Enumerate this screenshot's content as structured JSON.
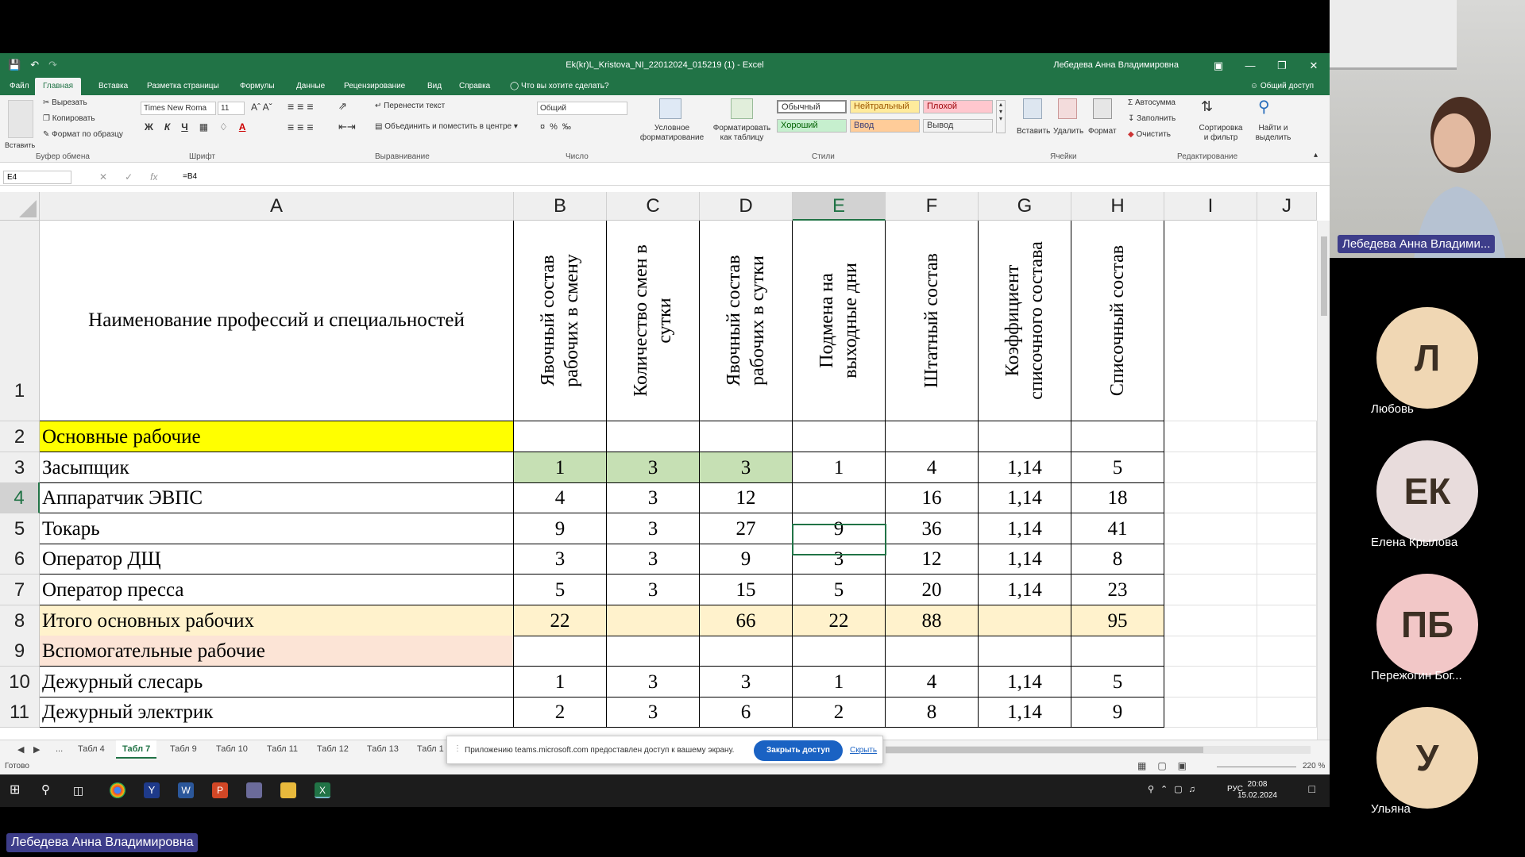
{
  "excel": {
    "doc_title": "Ek(kr)L_Kristova_NI_22012024_015219 (1)  -  Excel",
    "user": "Лебедева Анна Владимировна",
    "menu_tabs": [
      "Файл",
      "Главная",
      "Вставка",
      "Разметка страницы",
      "Формулы",
      "Данные",
      "Рецензирование",
      "Вид",
      "Справка",
      "Что вы хотите сделать?"
    ],
    "share": "Общий доступ",
    "ribbon": {
      "paste": "Вставить",
      "cut": "Вырезать",
      "copy": "Копировать",
      "format_painter": "Формат по образцу",
      "clipboard": "Буфер обмена",
      "font_name": "Times New Roma",
      "font_size": "11",
      "font_group": "Шрифт",
      "wrap": "Перенести текст",
      "merge": "Объединить и поместить в центре",
      "align_group": "Выравнивание",
      "number_format": "Общий",
      "number_group": "Число",
      "cond_format": "Условное форматирование",
      "format_table": "Форматировать как таблицу",
      "styles": [
        "Обычный",
        "Нейтральный",
        "Плохой",
        "Хороший",
        "Ввод",
        "Вывод"
      ],
      "styles_group": "Стили",
      "insert": "Вставить",
      "delete": "Удалить",
      "format": "Формат",
      "cells_group": "Ячейки",
      "autosum": "Автосумма",
      "fill": "Заполнить",
      "clear": "Очистить",
      "sort": "Сортировка и фильтр",
      "find": "Найти и выделить",
      "edit_group": "Редактирование"
    },
    "name_box": "E4",
    "formula": "=B4",
    "col_headers": [
      "A",
      "B",
      "C",
      "D",
      "E",
      "F",
      "G",
      "H",
      "I",
      "J"
    ],
    "header_row": {
      "A": "Наименование профессий и специальностей",
      "B": "Явочный состав рабочих в смену",
      "C": "Количество смен в сутки",
      "D": "Явочный состав рабочих в сутки",
      "E": "Подмена на выходные дни",
      "F": "Штатный состав",
      "G": "Коэффициент списочного состава",
      "H": "Списочный состав"
    },
    "rows": [
      {
        "n": "2",
        "cells": [
          "Основные рабочие",
          "",
          "",
          "",
          "",
          "",
          "",
          ""
        ]
      },
      {
        "n": "3",
        "cells": [
          "Засыпщик",
          "1",
          "3",
          "3",
          "1",
          "4",
          "1,14",
          "5"
        ]
      },
      {
        "n": "4",
        "cells": [
          "Аппаратчик ЭВПС",
          "4",
          "3",
          "12",
          "",
          "16",
          "1,14",
          "18"
        ]
      },
      {
        "n": "5",
        "cells": [
          "Токарь",
          "9",
          "3",
          "27",
          "9",
          "36",
          "1,14",
          "41"
        ]
      },
      {
        "n": "6",
        "cells": [
          "Оператор ДЩ",
          "3",
          "3",
          "9",
          "3",
          "12",
          "1,14",
          "8"
        ]
      },
      {
        "n": "7",
        "cells": [
          "Оператор пресса",
          "5",
          "3",
          "15",
          "5",
          "20",
          "1,14",
          "23"
        ]
      },
      {
        "n": "8",
        "cells": [
          "Итого основных рабочих",
          "22",
          "",
          "66",
          "22",
          "88",
          "",
          "95"
        ]
      },
      {
        "n": "9",
        "cells": [
          "Вспомогательные рабочие",
          "",
          "",
          "",
          "",
          "",
          "",
          ""
        ]
      },
      {
        "n": "10",
        "cells": [
          "Дежурный слесарь",
          "1",
          "3",
          "3",
          "1",
          "4",
          "1,14",
          "5"
        ]
      },
      {
        "n": "11",
        "cells": [
          "Дежурный электрик",
          "2",
          "3",
          "6",
          "2",
          "8",
          "1,14",
          "9"
        ]
      }
    ],
    "row1_label": "1",
    "sheet_tabs": [
      "...",
      "Табл 4",
      "Табл 7",
      "Табл 9",
      "Табл 10",
      "Табл 11",
      "Табл 12",
      "Табл 13",
      "Табл 1"
    ],
    "active_sheet": "Табл 7",
    "status": "Готово",
    "zoom": "220 %",
    "colors": {
      "excel_green": "#217346",
      "yellow": "#ffff00",
      "green_fill": "#c6e0b4",
      "total_fill": "#fff2cc",
      "aux_fill": "#fce4d6"
    }
  },
  "share_banner": {
    "message": "Приложению teams.microsoft.com предоставлен доступ к вашему экрану.",
    "stop": "Закрыть доступ",
    "hide": "Скрыть"
  },
  "taskbar": {
    "lang": "РУС",
    "time": "20:08",
    "date": "15.02.2024"
  },
  "participants": {
    "video_name": "Лебедева Анна Владими...",
    "list": [
      {
        "initials": "Л",
        "name": "Любовь"
      },
      {
        "initials": "ЕК",
        "name": "Елена Крылова"
      },
      {
        "initials": "ПБ",
        "name": "Пережогин Бог..."
      },
      {
        "initials": "У",
        "name": "Ульяна"
      }
    ]
  },
  "presenter": "Лебедева Анна Владимировна"
}
